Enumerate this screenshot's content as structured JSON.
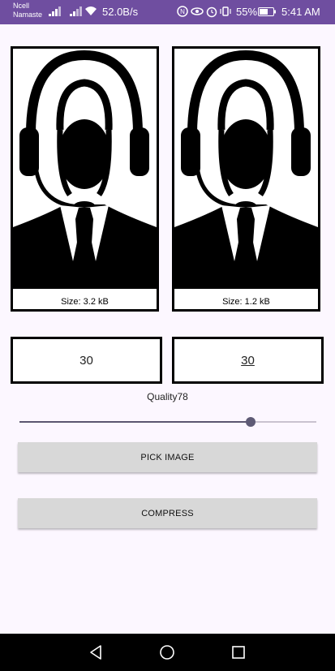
{
  "status_bar": {
    "carrier_line1": "Ncell",
    "carrier_line2": "Namaste",
    "net_speed": "52.0B/s",
    "battery": "55%",
    "time": "5:41 AM",
    "icons": [
      "signal-icon",
      "signal-icon",
      "wifi-icon",
      "nfc-icon",
      "eye-icon",
      "alarm-icon",
      "vibrate-icon",
      "battery-icon"
    ]
  },
  "images": {
    "original_size": "Size: 3.2 kB",
    "compressed_size": "Size: 1.2 kB"
  },
  "fields": {
    "left_value": "30",
    "right_value": "30"
  },
  "quality": {
    "label": "Quality78",
    "value": 78
  },
  "buttons": {
    "pick_image": "PICK IMAGE",
    "compress": "COMPRESS"
  },
  "nav": {
    "icons": [
      "back-icon",
      "home-icon",
      "recents-icon"
    ]
  },
  "colors": {
    "status_bar": "#6F4EA0",
    "background": "#FCF7FF",
    "button": "#D8D8D8",
    "slider_thumb": "#5E5A75"
  }
}
